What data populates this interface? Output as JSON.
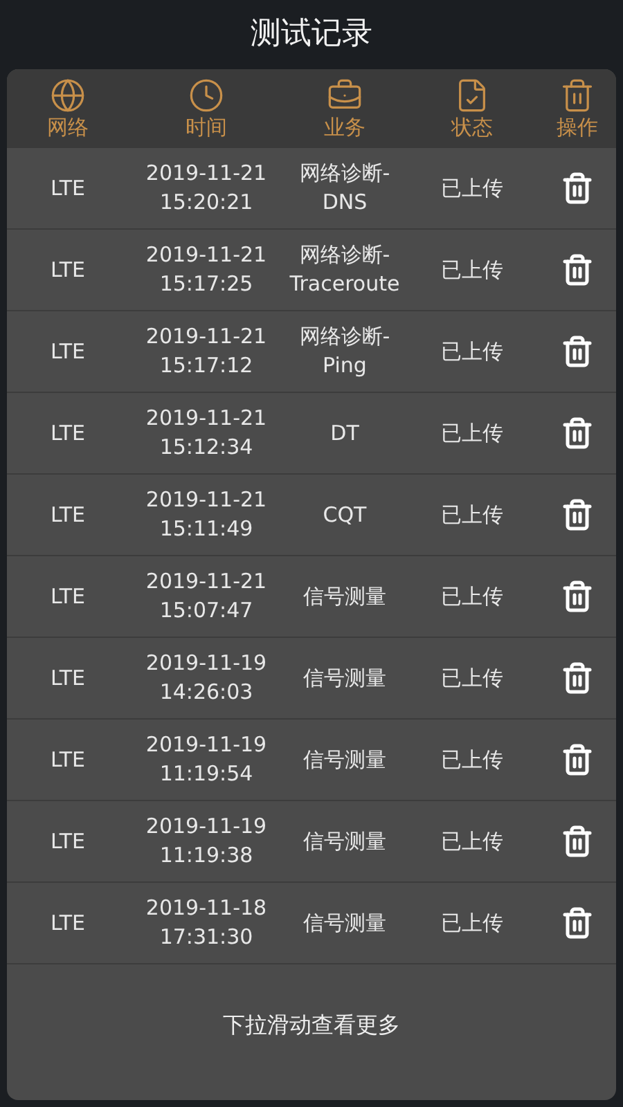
{
  "title": "测试记录",
  "columns": [
    {
      "label": "网络",
      "kind": "globe"
    },
    {
      "label": "时间",
      "kind": "clock"
    },
    {
      "label": "业务",
      "kind": "briefcase"
    },
    {
      "label": "状态",
      "kind": "check"
    },
    {
      "label": "操作",
      "kind": "bin"
    }
  ],
  "rows": [
    {
      "network": "LTE",
      "date": "2019-11-21",
      "time": "15:20:21",
      "service": "网络诊断-",
      "service_detail": "DNS",
      "status": "已上传"
    },
    {
      "network": "LTE",
      "date": "2019-11-21",
      "time": "15:17:25",
      "service": "网络诊断-",
      "service_detail": "Traceroute",
      "status": "已上传"
    },
    {
      "network": "LTE",
      "date": "2019-11-21",
      "time": "15:17:12",
      "service": "网络诊断-",
      "service_detail": "Ping",
      "status": "已上传"
    },
    {
      "network": "LTE",
      "date": "2019-11-21",
      "time": "15:12:34",
      "service": "DT",
      "status": "已上传"
    },
    {
      "network": "LTE",
      "date": "2019-11-21",
      "time": "15:11:49",
      "service": "CQT",
      "status": "已上传"
    },
    {
      "network": "LTE",
      "date": "2019-11-21",
      "time": "15:07:47",
      "service": "信号测量",
      "status": "已上传"
    },
    {
      "network": "LTE",
      "date": "2019-11-19",
      "time": "14:26:03",
      "service": "信号测量",
      "status": "已上传"
    },
    {
      "network": "LTE",
      "date": "2019-11-19",
      "time": "11:19:54",
      "service": "信号测量",
      "status": "已上传"
    },
    {
      "network": "LTE",
      "date": "2019-11-19",
      "time": "11:19:38",
      "service": "信号测量",
      "status": "已上传"
    },
    {
      "network": "LTE",
      "date": "2019-11-18",
      "time": "17:31:30",
      "service": "信号测量",
      "status": "已上传"
    }
  ],
  "footer": "下拉滑动查看更多"
}
